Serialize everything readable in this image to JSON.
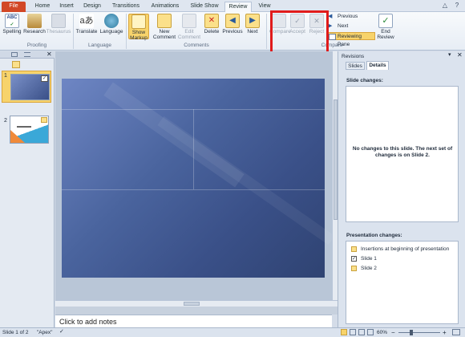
{
  "tabs": [
    "File",
    "Home",
    "Insert",
    "Design",
    "Transitions",
    "Animations",
    "Slide Show",
    "Review",
    "View"
  ],
  "active_tab": "Review",
  "ribbon": {
    "proofing": {
      "spelling": "Spelling",
      "research": "Research",
      "thesaurus": "Thesaurus",
      "group": "Proofing"
    },
    "language": {
      "translate": "Translate",
      "language": "Language",
      "group": "Language"
    },
    "comments": {
      "show_markup_1": "Show",
      "show_markup_2": "Markup",
      "new_1": "New",
      "new_2": "Comment",
      "edit_1": "Edit",
      "edit_2": "Comment",
      "delete": "Delete",
      "previous": "Previous",
      "next": "Next",
      "group": "Comments"
    },
    "compare": {
      "compare": "Compare",
      "accept": "Accept",
      "reject": "Reject",
      "previous": "Previous",
      "next": "Next",
      "reviewing_pane": "Reviewing Pane",
      "end_1": "End",
      "end_2": "Review",
      "group": "Compare"
    }
  },
  "slides_panel": {
    "thumb1_num": "1",
    "thumb2_num": "2"
  },
  "notes_placeholder": "Click to add notes",
  "revisions": {
    "title": "Revisions",
    "tab_slides": "Slides",
    "tab_details": "Details",
    "slide_changes_label": "Slide changes:",
    "slide_changes_msg": "No changes to this slide.  The next set of changes is on Slide 2.",
    "presentation_changes_label": "Presentation changes:",
    "presentation_changes": [
      "Insertions at beginning of presentation",
      "Slide 1",
      "Slide 2"
    ]
  },
  "status": {
    "slide": "Slide 1 of 2",
    "theme": "\"Apex\"",
    "zoom": "60%"
  },
  "colors": {
    "file_tab": "#d24726",
    "highlight": "#e01b1b",
    "active_button": "#f7d36b"
  }
}
